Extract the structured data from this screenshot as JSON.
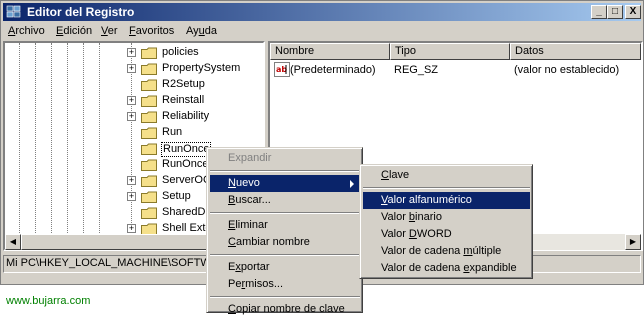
{
  "window": {
    "title": "Editor del Registro",
    "icon": "regedit-icon",
    "controls": [
      "_",
      "□",
      "X"
    ]
  },
  "menubar": [
    {
      "pre": "",
      "key": "A",
      "post": "rchivo"
    },
    {
      "pre": "",
      "key": "E",
      "post": "dición"
    },
    {
      "pre": "",
      "key": "V",
      "post": "er"
    },
    {
      "pre": "",
      "key": "F",
      "post": "avoritos"
    },
    {
      "pre": "Ay",
      "key": "u",
      "post": "da"
    }
  ],
  "tree": {
    "items": [
      {
        "label": "policies",
        "expandable": true
      },
      {
        "label": "PropertySystem",
        "expandable": true
      },
      {
        "label": "R2Setup",
        "expandable": false
      },
      {
        "label": "Reinstall",
        "expandable": true
      },
      {
        "label": "Reliability",
        "expandable": true
      },
      {
        "label": "Run",
        "expandable": false
      },
      {
        "label": "RunOnce",
        "expandable": false,
        "selected": true
      },
      {
        "label": "RunOnceE",
        "expandable": false
      },
      {
        "label": "ServerOC",
        "expandable": true
      },
      {
        "label": "Setup",
        "expandable": true
      },
      {
        "label": "SharedDlls",
        "expandable": false
      },
      {
        "label": "Shell Exte",
        "expandable": true
      }
    ]
  },
  "list": {
    "columns": [
      "Nombre",
      "Tipo",
      "Datos"
    ],
    "rows": [
      {
        "name": "(Predeterminado)",
        "type": "REG_SZ",
        "data": "(valor no establecido)"
      }
    ]
  },
  "statusbar": "Mi PC\\HKEY_LOCAL_MACHINE\\SOFTWARE",
  "context_menu": {
    "items": [
      {
        "pre": "Expandir",
        "key": "",
        "post": "",
        "disabled": true
      },
      {
        "sep": true
      },
      {
        "pre": "",
        "key": "N",
        "post": "uevo",
        "submenu": true,
        "highlighted": true
      },
      {
        "pre": "",
        "key": "B",
        "post": "uscar...",
        "submenu": false
      },
      {
        "sep": true
      },
      {
        "pre": "",
        "key": "E",
        "post": "liminar"
      },
      {
        "pre": "",
        "key": "C",
        "post": "ambiar nombre"
      },
      {
        "sep": true
      },
      {
        "pre": "E",
        "key": "x",
        "post": "portar"
      },
      {
        "pre": "Pe",
        "key": "r",
        "post": "misos..."
      },
      {
        "sep": true
      },
      {
        "pre": "",
        "key": "C",
        "post": "opiar nombre de clave"
      }
    ]
  },
  "submenu": {
    "items": [
      {
        "pre": "",
        "key": "C",
        "post": "lave"
      },
      {
        "sep": true
      },
      {
        "pre": "",
        "key": "V",
        "post": "alor alfanumérico",
        "highlighted": true
      },
      {
        "pre": "Valor ",
        "key": "b",
        "post": "inario"
      },
      {
        "pre": "Valor ",
        "key": "D",
        "post": "WORD"
      },
      {
        "pre": "Valor de cadena ",
        "key": "m",
        "post": "últiple"
      },
      {
        "pre": "Valor de cadena ",
        "key": "e",
        "post": "xpandible"
      }
    ]
  },
  "footer": "www.bujarra.com",
  "colors": {
    "titlebar": "#0a246a",
    "highlight": "#0a246a",
    "chrome": "#d4d0c8",
    "footer": "#008000"
  }
}
